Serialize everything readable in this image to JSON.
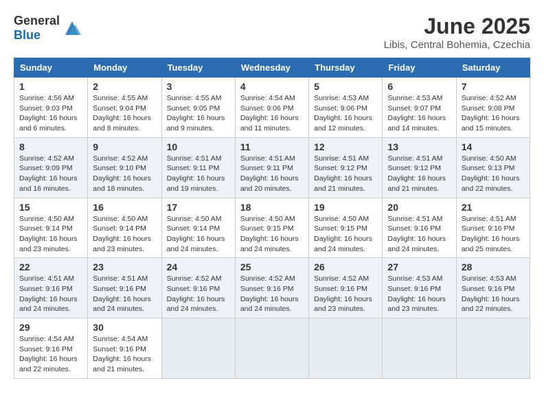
{
  "header": {
    "logo_general": "General",
    "logo_blue": "Blue",
    "month_year": "June 2025",
    "location": "Libis, Central Bohemia, Czechia"
  },
  "columns": [
    "Sunday",
    "Monday",
    "Tuesday",
    "Wednesday",
    "Thursday",
    "Friday",
    "Saturday"
  ],
  "weeks": [
    [
      {
        "day": "1",
        "sunrise": "4:56 AM",
        "sunset": "9:03 PM",
        "daylight": "16 hours and 6 minutes."
      },
      {
        "day": "2",
        "sunrise": "4:55 AM",
        "sunset": "9:04 PM",
        "daylight": "16 hours and 8 minutes."
      },
      {
        "day": "3",
        "sunrise": "4:55 AM",
        "sunset": "9:05 PM",
        "daylight": "16 hours and 9 minutes."
      },
      {
        "day": "4",
        "sunrise": "4:54 AM",
        "sunset": "9:06 PM",
        "daylight": "16 hours and 11 minutes."
      },
      {
        "day": "5",
        "sunrise": "4:53 AM",
        "sunset": "9:06 PM",
        "daylight": "16 hours and 12 minutes."
      },
      {
        "day": "6",
        "sunrise": "4:53 AM",
        "sunset": "9:07 PM",
        "daylight": "16 hours and 14 minutes."
      },
      {
        "day": "7",
        "sunrise": "4:52 AM",
        "sunset": "9:08 PM",
        "daylight": "16 hours and 15 minutes."
      }
    ],
    [
      {
        "day": "8",
        "sunrise": "4:52 AM",
        "sunset": "9:09 PM",
        "daylight": "16 hours and 16 minutes."
      },
      {
        "day": "9",
        "sunrise": "4:52 AM",
        "sunset": "9:10 PM",
        "daylight": "16 hours and 18 minutes."
      },
      {
        "day": "10",
        "sunrise": "4:51 AM",
        "sunset": "9:11 PM",
        "daylight": "16 hours and 19 minutes."
      },
      {
        "day": "11",
        "sunrise": "4:51 AM",
        "sunset": "9:11 PM",
        "daylight": "16 hours and 20 minutes."
      },
      {
        "day": "12",
        "sunrise": "4:51 AM",
        "sunset": "9:12 PM",
        "daylight": "16 hours and 21 minutes."
      },
      {
        "day": "13",
        "sunrise": "4:51 AM",
        "sunset": "9:12 PM",
        "daylight": "16 hours and 21 minutes."
      },
      {
        "day": "14",
        "sunrise": "4:50 AM",
        "sunset": "9:13 PM",
        "daylight": "16 hours and 22 minutes."
      }
    ],
    [
      {
        "day": "15",
        "sunrise": "4:50 AM",
        "sunset": "9:14 PM",
        "daylight": "16 hours and 23 minutes."
      },
      {
        "day": "16",
        "sunrise": "4:50 AM",
        "sunset": "9:14 PM",
        "daylight": "16 hours and 23 minutes."
      },
      {
        "day": "17",
        "sunrise": "4:50 AM",
        "sunset": "9:14 PM",
        "daylight": "16 hours and 24 minutes."
      },
      {
        "day": "18",
        "sunrise": "4:50 AM",
        "sunset": "9:15 PM",
        "daylight": "16 hours and 24 minutes."
      },
      {
        "day": "19",
        "sunrise": "4:50 AM",
        "sunset": "9:15 PM",
        "daylight": "16 hours and 24 minutes."
      },
      {
        "day": "20",
        "sunrise": "4:51 AM",
        "sunset": "9:16 PM",
        "daylight": "16 hours and 24 minutes."
      },
      {
        "day": "21",
        "sunrise": "4:51 AM",
        "sunset": "9:16 PM",
        "daylight": "16 hours and 25 minutes."
      }
    ],
    [
      {
        "day": "22",
        "sunrise": "4:51 AM",
        "sunset": "9:16 PM",
        "daylight": "16 hours and 24 minutes."
      },
      {
        "day": "23",
        "sunrise": "4:51 AM",
        "sunset": "9:16 PM",
        "daylight": "16 hours and 24 minutes."
      },
      {
        "day": "24",
        "sunrise": "4:52 AM",
        "sunset": "9:16 PM",
        "daylight": "16 hours and 24 minutes."
      },
      {
        "day": "25",
        "sunrise": "4:52 AM",
        "sunset": "9:16 PM",
        "daylight": "16 hours and 24 minutes."
      },
      {
        "day": "26",
        "sunrise": "4:52 AM",
        "sunset": "9:16 PM",
        "daylight": "16 hours and 23 minutes."
      },
      {
        "day": "27",
        "sunrise": "4:53 AM",
        "sunset": "9:16 PM",
        "daylight": "16 hours and 23 minutes."
      },
      {
        "day": "28",
        "sunrise": "4:53 AM",
        "sunset": "9:16 PM",
        "daylight": "16 hours and 22 minutes."
      }
    ],
    [
      {
        "day": "29",
        "sunrise": "4:54 AM",
        "sunset": "9:16 PM",
        "daylight": "16 hours and 22 minutes."
      },
      {
        "day": "30",
        "sunrise": "4:54 AM",
        "sunset": "9:16 PM",
        "daylight": "16 hours and 21 minutes."
      },
      null,
      null,
      null,
      null,
      null
    ]
  ]
}
